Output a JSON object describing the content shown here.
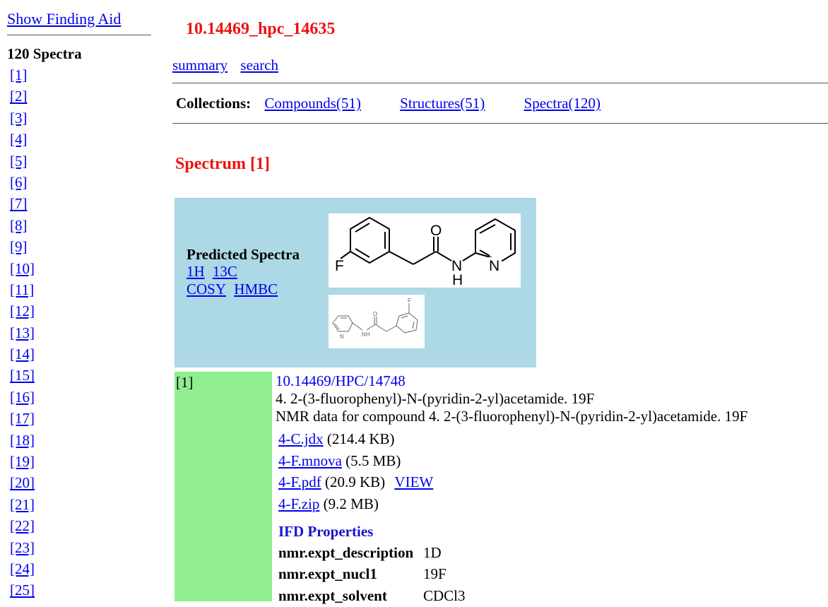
{
  "sidebar": {
    "finding_aid_label": "Show Finding Aid",
    "spectra_count_label": "120 Spectra",
    "spectrum_links": [
      "[1]",
      "[2]",
      "[3]",
      "[4]",
      "[5]",
      "[6]",
      "[7]",
      "[8]",
      "[9]",
      "[10]",
      "[11]",
      "[12]",
      "[13]",
      "[14]",
      "[15]",
      "[16]",
      "[17]",
      "[18]",
      "[19]",
      "[20]",
      "[21]",
      "[22]",
      "[23]",
      "[24]",
      "[25]"
    ]
  },
  "header": {
    "title": "10.14469_hpc_14635",
    "nav": {
      "summary": "summary",
      "search": "search"
    }
  },
  "collections": {
    "label": "Collections:",
    "compounds": "Compounds(51)",
    "structures": "Structures(51)",
    "spectra": "Spectra(120)"
  },
  "spectrum": {
    "heading": "Spectrum [1]",
    "predicted": {
      "label": "Predicted Spectra",
      "links": {
        "h1": "1H",
        "c13": "13C",
        "cosy": "COSY",
        "hmbc": "HMBC"
      }
    },
    "structure_labels": {
      "fluorine": "F",
      "oxygen": "O",
      "nitrogen": "N",
      "hydrogen": "H"
    },
    "record": {
      "index": "[1]",
      "doi": "10.14469/HPC/14748",
      "name": "4. 2-(3-fluorophenyl)-N-(pyridin-2-yl)acetamide. 19F",
      "description": "NMR data for compound 4. 2-(3-fluorophenyl)-N-(pyridin-2-yl)acetamide. 19F",
      "files": [
        {
          "name": "4-C.jdx",
          "size": "(214.4 KB)"
        },
        {
          "name": "4-F.mnova",
          "size": "(5.5 MB)"
        },
        {
          "name": "4-F.pdf",
          "size": "(20.9 KB)",
          "view": "VIEW"
        },
        {
          "name": "4-F.zip",
          "size": "(9.2 MB)"
        }
      ],
      "ifd_heading": "IFD Properties",
      "properties": [
        {
          "key": "nmr.expt_description",
          "value": "1D"
        },
        {
          "key": "nmr.expt_nucl1",
          "value": "19F"
        },
        {
          "key": "nmr.expt_solvent",
          "value": "CDCl3"
        }
      ]
    }
  },
  "colors": {
    "title_red": "#ee1111",
    "link_blue": "#0000ee",
    "ifd_blue": "#1515cc",
    "panel_blue": "#add8e6",
    "record_green": "#90ee90"
  }
}
